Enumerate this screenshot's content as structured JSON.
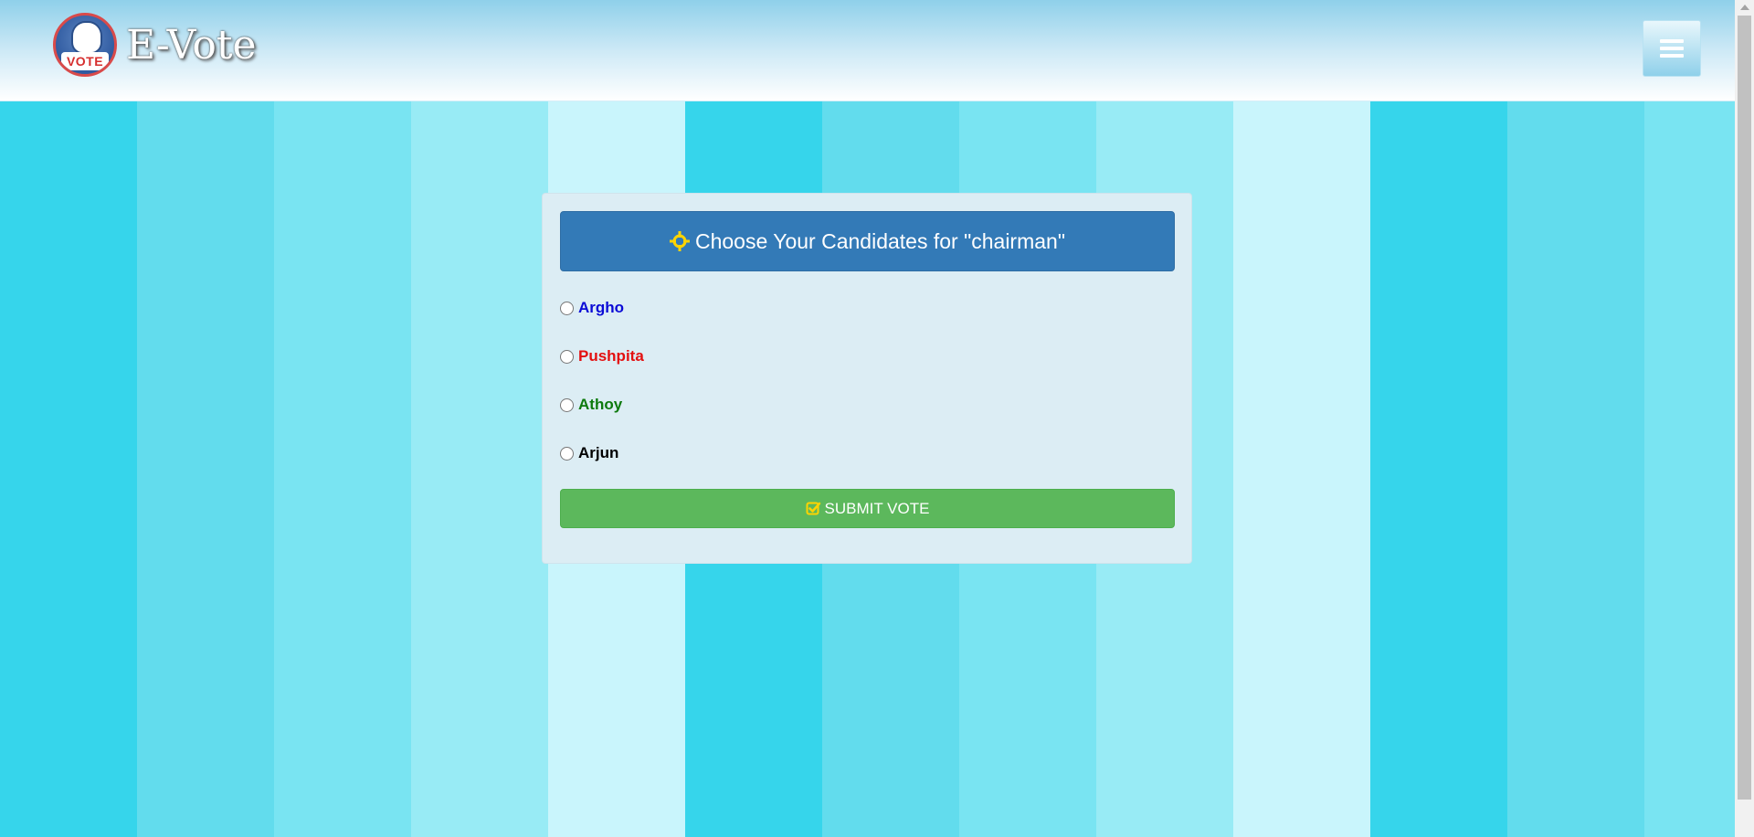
{
  "brand": {
    "name": "E-Vote",
    "logo_text": "VOTE"
  },
  "ballot": {
    "title": "Choose Your Candidates for \"chairman\"",
    "candidates": [
      {
        "name": "Argho",
        "color": "#0b0bd6"
      },
      {
        "name": "Pushpita",
        "color": "#e31010"
      },
      {
        "name": "Athoy",
        "color": "#0d7a0d"
      },
      {
        "name": "Arjun",
        "color": "#000000"
      }
    ],
    "submit_label": "SUBMIT VOTE"
  },
  "icons": {
    "header": "crosshairs-icon",
    "submit": "check-square-icon",
    "menu": "hamburger-icon"
  },
  "colors": {
    "header_bg": "#337ab7",
    "submit_bg": "#5cb85c",
    "icon_accent": "#ffd400"
  }
}
